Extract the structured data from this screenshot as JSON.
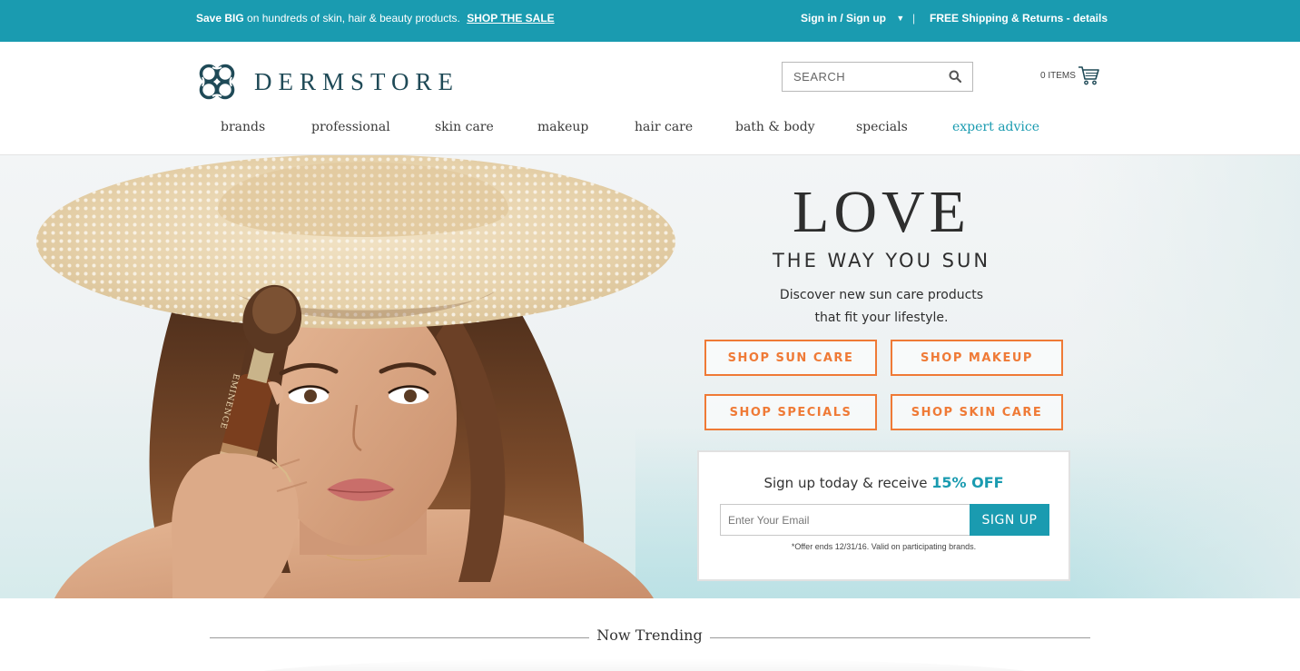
{
  "topbar": {
    "promo_bold": "Save BIG",
    "promo_text": "on hundreds of skin, hair & beauty products.",
    "promo_link": "SHOP THE SALE",
    "account": "Sign in / Sign up",
    "separator": "|",
    "shipping": "FREE Shipping & Returns - details"
  },
  "header": {
    "brand": "DERMSTORE",
    "search_placeholder": "SEARCH",
    "cart_label": "0 ITEMS"
  },
  "nav": {
    "items": [
      "brands",
      "professional",
      "skin care",
      "makeup",
      "hair care",
      "bath & body",
      "specials",
      "expert advice"
    ]
  },
  "hero": {
    "headline": "LOVE",
    "subheadline": "THE WAY YOU SUN",
    "body_line1": "Discover new sun care products",
    "body_line2": "that fit your lifestyle.",
    "buttons": [
      "SHOP SUN CARE",
      "SHOP MAKEUP",
      "SHOP SPECIALS",
      "SHOP SKIN CARE"
    ],
    "brush_brand": "EMINENCE"
  },
  "signup": {
    "lead": "Sign up today & receive",
    "offer": "15% OFF",
    "email_placeholder": "Enter Your Email",
    "button": "SIGN UP",
    "fine_print": "*Offer ends 12/31/16. Valid on participating brands."
  },
  "trending": {
    "title": "Now Trending"
  },
  "colors": {
    "teal": "#1a9bb0",
    "orange": "#ef7a36",
    "logo": "#1f4a57"
  },
  "icons": {
    "logo": "knot-logo-icon",
    "search": "search-icon",
    "cart": "cart-icon",
    "dropdown": "chevron-down-icon"
  }
}
